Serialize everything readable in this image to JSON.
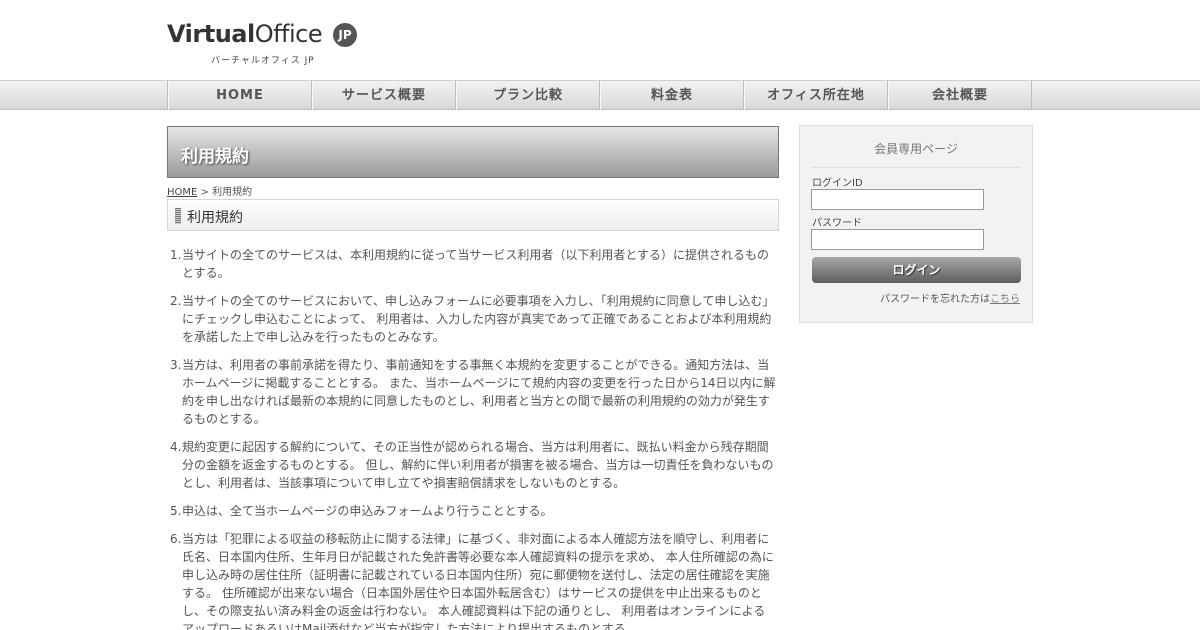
{
  "header": {
    "logo_main_bold": "Virtual",
    "logo_main_regular": "Office",
    "logo_badge": "JP",
    "logo_sub": "バーチャルオフィス JP"
  },
  "nav": {
    "items": [
      {
        "label": "HOME"
      },
      {
        "label": "サービス概要"
      },
      {
        "label": "プラン比較"
      },
      {
        "label": "料金表"
      },
      {
        "label": "オフィス所在地"
      },
      {
        "label": "会社概要"
      }
    ]
  },
  "main": {
    "page_title": "利用規約",
    "breadcrumb_home": "HOME",
    "breadcrumb_sep": " > ",
    "breadcrumb_current": "利用規約",
    "section_heading": "利用規約",
    "terms": [
      {
        "num": "1.",
        "text": "当サイトの全てのサービスは、本利用規約に従って当サービス利用者（以下利用者とする）に提供されるものとする。"
      },
      {
        "num": "2.",
        "text": "当サイトの全てのサービスにおいて、申し込みフォームに必要事項を入力し、「利用規約に同意して申し込む」にチェックし申込むことによって、 利用者は、入力した内容が真実であって正確であることおよび本利用規約を承諾した上で申し込みを行ったものとみなす。"
      },
      {
        "num": "3.",
        "text": "当方は、利用者の事前承諾を得たり、事前通知をする事無く本規約を変更することができる。通知方法は、当ホームページに掲載することとする。 また、当ホームページにて規約内容の変更を行った日から14日以内に解約を申し出なければ最新の本規約に同意したものとし、利用者と当方との間で最新の利用規約の効力が発生するものとする。"
      },
      {
        "num": "4.",
        "text": "規約変更に起因する解約について、その正当性が認められる場合、当方は利用者に、既払い料金から残存期間分の金額を返金するものとする。 但し、解約に伴い利用者が損害を被る場合、当方は一切責任を負わないものとし、利用者は、当該事項について申し立てや損害賠償請求をしないものとする。"
      },
      {
        "num": "5.",
        "text": "申込は、全て当ホームページの申込みフォームより行うこととする。"
      },
      {
        "num": "6.",
        "text": "当方は「犯罪による収益の移転防止に関する法律」に基づく、非対面による本人確認方法を順守し、利用者に氏名、日本国内住所、生年月日が記載された免許書等必要な本人確認資料の提示を求め、 本人住所確認の為に申し込み時の居住住所（証明書に記載されている日本国内住所）宛に郵便物を送付し、法定の居住確認を実施する。 住所確認が出来ない場合（日本国外居住や日本国外転居含む）はサービスの提供を中止出来るものとし、その際支払い済み料金の返金は行わない。 本人確認資料は下記の通りとし、 利用者はオンラインによるアップロードあるいはMail添付など当方が指定した方法により提出するものとする。"
      }
    ]
  },
  "sidebar": {
    "title": "会員専用ページ",
    "login_id_label": "ログインID",
    "login_id_value": "",
    "password_label": "パスワード",
    "password_value": "",
    "login_button": "ログイン",
    "forgot_text": "パスワードを忘れた方は",
    "forgot_link": "こちら"
  }
}
